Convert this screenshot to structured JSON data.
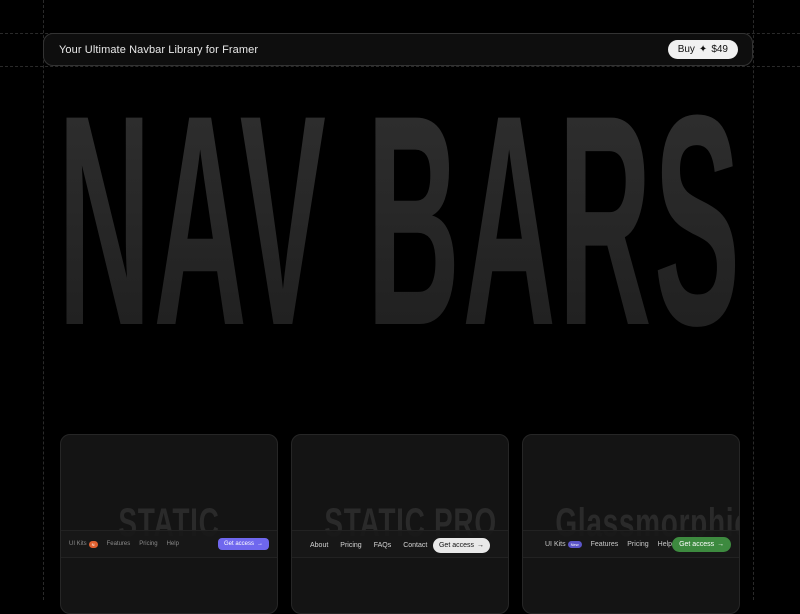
{
  "topbar": {
    "title": "Your Ultimate Navbar Library for Framer",
    "buy_label": "Buy",
    "buy_icon": "sparkle-icon",
    "buy_price": "$49"
  },
  "hero": {
    "title": "NAV BARS"
  },
  "cards": [
    {
      "heading": "STATIC",
      "nav": {
        "links": [
          {
            "label": "UI Kits",
            "badge": "N"
          },
          {
            "label": "Features"
          },
          {
            "label": "Pricing"
          },
          {
            "label": "Help"
          }
        ],
        "cta": "Get access",
        "cta_color": "#6f67ee",
        "badge_color": "#e0602f"
      }
    },
    {
      "heading": "STATIC PRO",
      "nav": {
        "links": [
          {
            "label": "About"
          },
          {
            "label": "Pricing"
          },
          {
            "label": "FAQs"
          },
          {
            "label": "Contact"
          }
        ],
        "cta": "Get access"
      }
    },
    {
      "heading": "Glassmorphic",
      "nav": {
        "links": [
          {
            "label": "UI Kits",
            "badge": "New"
          },
          {
            "label": "Features"
          },
          {
            "label": "Pricing"
          },
          {
            "label": "Help"
          }
        ],
        "cta": "Get access",
        "cta_color": "#3d8a3f",
        "badge_color": "#5b55c9"
      }
    }
  ]
}
